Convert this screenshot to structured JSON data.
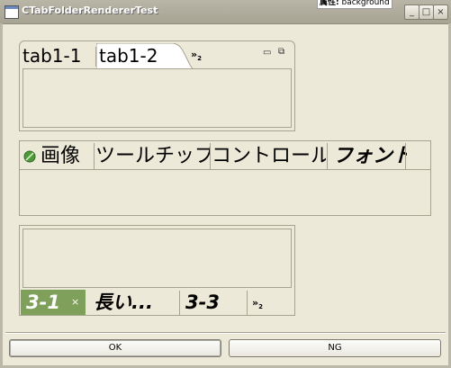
{
  "window": {
    "title": "CTabFolderRendererTest",
    "tooltip_label": "属性:",
    "tooltip_value": "background",
    "minimize": "_",
    "maximize": "□",
    "close": "×"
  },
  "folder1": {
    "tabs": [
      {
        "label": "tab1-1",
        "selected": false
      },
      {
        "label": "tab1-2",
        "selected": true
      }
    ],
    "chevron": "»",
    "chevron_count": "2",
    "minimize": "▭",
    "restore": "⧉"
  },
  "folder2": {
    "tabs": [
      {
        "label": "画像",
        "icon": "leaf-icon"
      },
      {
        "label": "ツールチップ"
      },
      {
        "label": "コントロール"
      },
      {
        "label": "フォント"
      }
    ]
  },
  "folder3": {
    "tabs": [
      {
        "label": "3-1",
        "selected": true,
        "close": "×"
      },
      {
        "label": "長い..."
      },
      {
        "label": "3-3"
      }
    ],
    "chevron": "»",
    "chevron_count": "2",
    "selected_color": "#7fa05a"
  },
  "buttons": {
    "ok": "OK",
    "ng": "NG"
  }
}
